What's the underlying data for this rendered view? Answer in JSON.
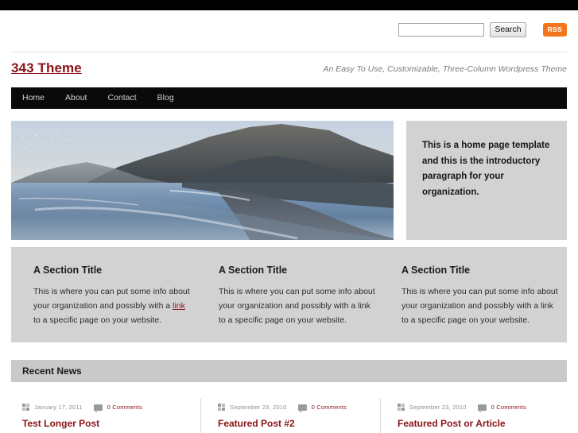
{
  "topbar": {
    "present": true
  },
  "search": {
    "value": "",
    "placeholder": "",
    "button_label": "Search",
    "rss_label": "RSS",
    "rss_color": "#f4761c"
  },
  "header": {
    "site_title": "343 Theme",
    "site_title_color": "#8a1418",
    "tagline": "An Easy To Use, Customizable, Three-Column Wordpress Theme"
  },
  "nav": {
    "items": [
      {
        "label": "Home"
      },
      {
        "label": "About"
      },
      {
        "label": "Contact"
      },
      {
        "label": "Blog"
      }
    ]
  },
  "hero": {
    "image_alt": "coastal-ocean-headland-photo",
    "intro_text": "This is a home page template and this is the introductory paragraph for your organization."
  },
  "sections": [
    {
      "title": "A Section Title",
      "text_before": "This is where you can put some info about your organization and possibly with a ",
      "link_label": "link",
      "text_after": " to a specific page on your website.",
      "link_styled": true
    },
    {
      "title": "A Section Title",
      "text_before": "This is where you can put some info about your organization and possibly with a ",
      "link_label": "link",
      "text_after": " to a specific page on your website.",
      "link_styled": false
    },
    {
      "title": "A Section Title",
      "text_before": "This is where you can put some info about your organization and possibly with a ",
      "link_label": "link",
      "text_after": " to a specific page on your website.",
      "link_styled": false
    }
  ],
  "news": {
    "heading": "Recent News",
    "posts": [
      {
        "date": "January 17, 2011",
        "comments": "0 Comments",
        "title": "Test Longer Post"
      },
      {
        "date": "September 23, 2010",
        "comments": "0 Comments",
        "title": "Featured Post #2"
      },
      {
        "date": "September 23, 2010",
        "comments": "0 Comments",
        "title": "Featured Post or Article"
      }
    ]
  },
  "colors": {
    "accent": "#8a1418",
    "panel_gray": "#d2d2d2",
    "bar_gray": "#c9c9c9",
    "nav_black": "#0a0a0a",
    "rss_orange": "#f4761c"
  }
}
